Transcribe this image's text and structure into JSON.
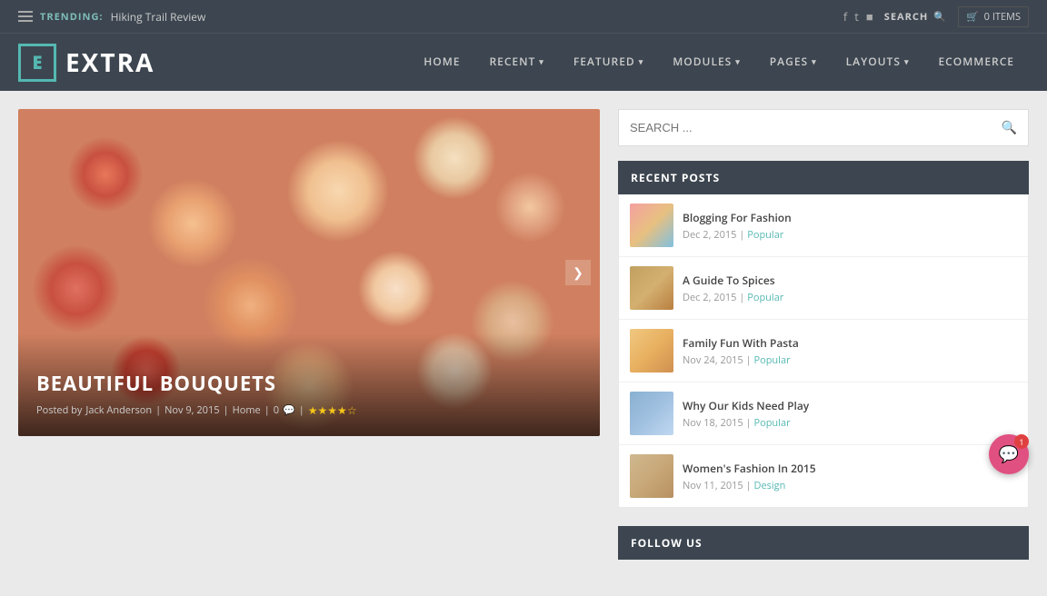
{
  "topbar": {
    "hamburger_label": "menu",
    "trending_label": "TRENDING:",
    "trending_link": "Hiking Trail Review",
    "search_label": "SEARCH",
    "cart_label": "0 ITEMS",
    "social": [
      "f",
      "t",
      "◻"
    ]
  },
  "navbar": {
    "logo_letter": "E",
    "logo_text": "EXTRA",
    "nav_items": [
      {
        "label": "HOME",
        "has_caret": false
      },
      {
        "label": "RECENT",
        "has_caret": true
      },
      {
        "label": "FEATURED",
        "has_caret": true
      },
      {
        "label": "MODULES",
        "has_caret": true
      },
      {
        "label": "PAGES",
        "has_caret": true
      },
      {
        "label": "LAYOUTS",
        "has_caret": true
      },
      {
        "label": "ECOMMERCE",
        "has_caret": false
      }
    ]
  },
  "featured": {
    "title": "BEAUTIFUL BOUQUETS",
    "meta_prefix": "Posted by",
    "author": "Jack Anderson",
    "date": "Nov 9, 2015",
    "category": "Home",
    "comments": "0",
    "rating": "★★★★☆"
  },
  "search": {
    "placeholder": "SEARCH ..."
  },
  "recent_posts": {
    "section_title": "RECENT POSTS",
    "posts": [
      {
        "title": "Blogging For Fashion",
        "date": "Dec 2, 2015",
        "tag": "Popular",
        "thumb_class": "thumb-fashion"
      },
      {
        "title": "A Guide To Spices",
        "date": "Dec 2, 2015",
        "tag": "Popular",
        "thumb_class": "thumb-spices"
      },
      {
        "title": "Family Fun With Pasta",
        "date": "Nov 24, 2015",
        "tag": "Popular",
        "thumb_class": "thumb-pasta"
      },
      {
        "title": "Why Our Kids Need Play",
        "date": "Nov 18, 2015",
        "tag": "Popular",
        "thumb_class": "thumb-kids"
      },
      {
        "title": "Women's Fashion In 2015",
        "date": "Nov 11, 2015",
        "tag": "Design",
        "thumb_class": "thumb-womens"
      }
    ]
  },
  "follow": {
    "section_title": "FOLLOW US"
  },
  "chat": {
    "badge": "1"
  }
}
